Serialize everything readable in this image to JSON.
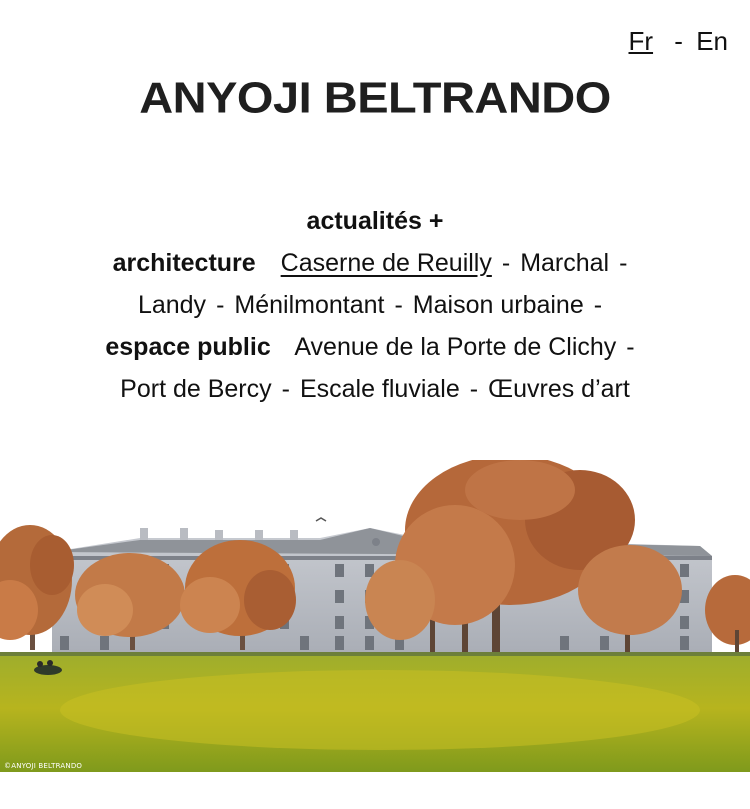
{
  "lang": {
    "fr": "Fr",
    "separator": "-",
    "en": "En"
  },
  "logo": "ANYOJI BELTRANDO",
  "nav": {
    "news": "actualités +",
    "architecture": {
      "label": "architecture",
      "items": [
        "Caserne de Reuilly",
        "Marchal",
        "Landy",
        "Ménilmontant",
        "Maison urbaine"
      ]
    },
    "public_space": {
      "label": "espace public",
      "items": [
        "Avenue de la Porte de Clichy",
        "Port de Bercy",
        "Escale fluviale",
        "Œuvres d’art"
      ]
    },
    "separator": "-"
  },
  "hero": {
    "credit": "©ANYOJI BELTRANDO"
  }
}
